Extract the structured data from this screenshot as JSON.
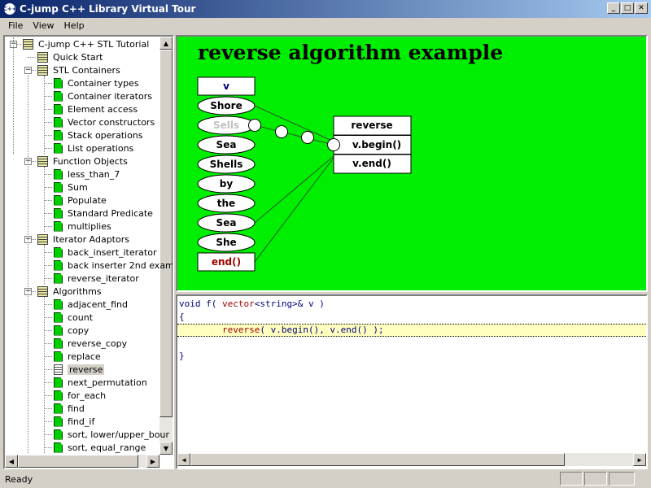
{
  "window": {
    "title": "C-jump C++ Library Virtual Tour",
    "icon": "cjump-logo-icon",
    "buttons": [
      "minimize",
      "maximize",
      "close"
    ]
  },
  "menu": [
    "File",
    "View",
    "Help"
  ],
  "tree": [
    {
      "label": "C-jump C++ STL Tutorial",
      "level": 0,
      "icon": "book",
      "expanded": true
    },
    {
      "label": "Quick Start",
      "level": 1,
      "icon": "book"
    },
    {
      "label": "STL Containers",
      "level": 1,
      "icon": "book",
      "expanded": true
    },
    {
      "label": "Container types",
      "level": 2,
      "icon": "page"
    },
    {
      "label": "Container iterators",
      "level": 2,
      "icon": "page"
    },
    {
      "label": "Element access",
      "level": 2,
      "icon": "page"
    },
    {
      "label": "Vector constructors",
      "level": 2,
      "icon": "page"
    },
    {
      "label": "Stack operations",
      "level": 2,
      "icon": "page"
    },
    {
      "label": "List operations",
      "level": 2,
      "icon": "page"
    },
    {
      "label": "Function Objects",
      "level": 1,
      "icon": "book",
      "expanded": true
    },
    {
      "label": "less_than_7",
      "level": 2,
      "icon": "page"
    },
    {
      "label": "Sum",
      "level": 2,
      "icon": "page"
    },
    {
      "label": "Populate",
      "level": 2,
      "icon": "page"
    },
    {
      "label": "Standard Predicate",
      "level": 2,
      "icon": "page"
    },
    {
      "label": "multiplies",
      "level": 2,
      "icon": "page"
    },
    {
      "label": "Iterator Adaptors",
      "level": 1,
      "icon": "book",
      "expanded": true
    },
    {
      "label": "back_insert_iterator",
      "level": 2,
      "icon": "page"
    },
    {
      "label": "back inserter 2nd exam",
      "level": 2,
      "icon": "page"
    },
    {
      "label": "reverse_iterator",
      "level": 2,
      "icon": "page"
    },
    {
      "label": "Algorithms",
      "level": 1,
      "icon": "book",
      "expanded": true
    },
    {
      "label": "adjacent_find",
      "level": 2,
      "icon": "page"
    },
    {
      "label": "count",
      "level": 2,
      "icon": "page"
    },
    {
      "label": "copy",
      "level": 2,
      "icon": "page"
    },
    {
      "label": "reverse_copy",
      "level": 2,
      "icon": "page"
    },
    {
      "label": "replace",
      "level": 2,
      "icon": "page"
    },
    {
      "label": "reverse",
      "level": 2,
      "icon": "page-selected",
      "selected": true
    },
    {
      "label": "next_permutation",
      "level": 2,
      "icon": "page"
    },
    {
      "label": "for_each",
      "level": 2,
      "icon": "page"
    },
    {
      "label": "find",
      "level": 2,
      "icon": "page"
    },
    {
      "label": "find_if",
      "level": 2,
      "icon": "page"
    },
    {
      "label": "sort, lower/upper_bour",
      "level": 2,
      "icon": "page"
    },
    {
      "label": "sort, equal_range",
      "level": 2,
      "icon": "page"
    }
  ],
  "diagram": {
    "title": "reverse algorithm example",
    "container_label": "v",
    "elements": [
      "Shore",
      "Sells",
      "Sea",
      "Shells",
      "by",
      "the",
      "Sea",
      "She"
    ],
    "end_label": "end()",
    "algorithm": {
      "name": "reverse",
      "args": [
        "v.begin()",
        "v.end()"
      ]
    },
    "colors": {
      "background": "#00ee00",
      "container_label": "#000080",
      "end_label": "#a00000",
      "faded_element": "#c0c0c0"
    }
  },
  "code": {
    "lines": [
      {
        "parts": [
          {
            "t": "void f( ",
            "c": "kw"
          },
          {
            "t": "vector",
            "c": "ty"
          },
          {
            "t": "<string>& v )",
            "c": "kw"
          }
        ]
      },
      {
        "parts": [
          {
            "t": "{",
            "c": "kw"
          }
        ]
      },
      {
        "parts": [
          {
            "t": "        ",
            "c": ""
          },
          {
            "t": "reverse",
            "c": "ty"
          },
          {
            "t": "( v.begin(), v.end() );",
            "c": "kw"
          }
        ],
        "highlight": true
      },
      {
        "parts": []
      },
      {
        "parts": [
          {
            "t": "}",
            "c": "kw"
          }
        ]
      }
    ],
    "highlight_color": "#ffffc0"
  },
  "status": "Ready"
}
